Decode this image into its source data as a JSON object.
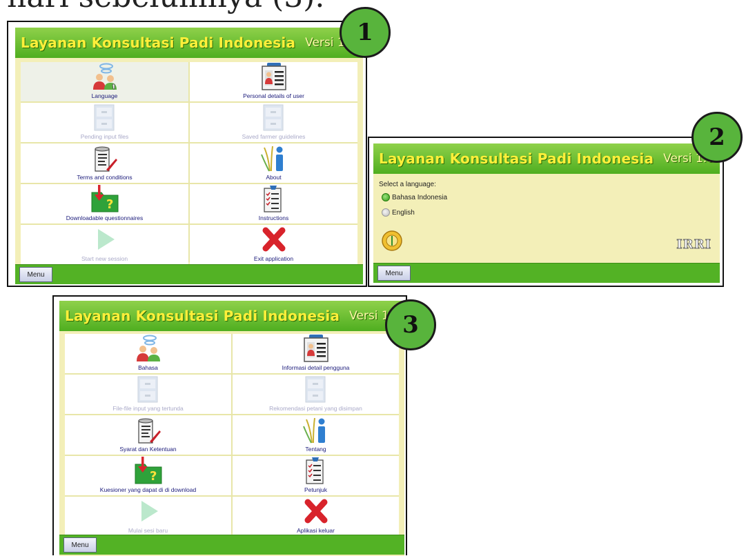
{
  "caption": "nari sebelumnya (3).",
  "app_title": "Layanan Konsultasi Padi Indonesia",
  "app_version": "Versi 1.0",
  "menu_label": "Menu",
  "badges": [
    "1",
    "2",
    "3"
  ],
  "screen1": {
    "items": [
      {
        "label": "Language",
        "icon": "language-icon"
      },
      {
        "label": "Personal details of user",
        "icon": "user-id-card-icon"
      },
      {
        "label": "Pending input files",
        "icon": "file-cabinet-icon"
      },
      {
        "label": "Saved farmer guidelines",
        "icon": "file-cabinet-icon"
      },
      {
        "label": "Terms and conditions",
        "icon": "document-pen-icon"
      },
      {
        "label": "About",
        "icon": "info-rice-icon"
      },
      {
        "label": "Downloadable questionnaires",
        "icon": "download-folder-icon"
      },
      {
        "label": "Instructions",
        "icon": "checklist-icon"
      },
      {
        "label": "Start new session",
        "icon": "play-icon"
      },
      {
        "label": "Exit application",
        "icon": "exit-x-icon"
      }
    ]
  },
  "screen2": {
    "prompt": "Select a language:",
    "options": [
      "Bahasa Indonesia",
      "English"
    ],
    "selected": "Bahasa Indonesia",
    "logo_text": "IRRI"
  },
  "screen3": {
    "items": [
      {
        "label": "Bahasa",
        "icon": "language-icon"
      },
      {
        "label": "Informasi detail pengguna",
        "icon": "user-id-card-icon"
      },
      {
        "label": "File-file input yang tertunda",
        "icon": "file-cabinet-icon"
      },
      {
        "label": "Rekomendasi petani yang disimpan",
        "icon": "file-cabinet-icon"
      },
      {
        "label": "Syarat dan Ketentuan",
        "icon": "document-pen-icon"
      },
      {
        "label": "Tentang",
        "icon": "info-rice-icon"
      },
      {
        "label": "Kuesioner yang dapat di di download",
        "icon": "download-folder-icon"
      },
      {
        "label": "Petunjuk",
        "icon": "checklist-icon"
      },
      {
        "label": "Mulai sesi baru",
        "icon": "play-icon"
      },
      {
        "label": "Aplikasi keluar",
        "icon": "exit-x-icon"
      }
    ]
  },
  "colors": {
    "title_bar": "#4fae20",
    "title_text": "#ffef3a",
    "app_background": "#f3efb8",
    "badge": "#58b43c"
  }
}
